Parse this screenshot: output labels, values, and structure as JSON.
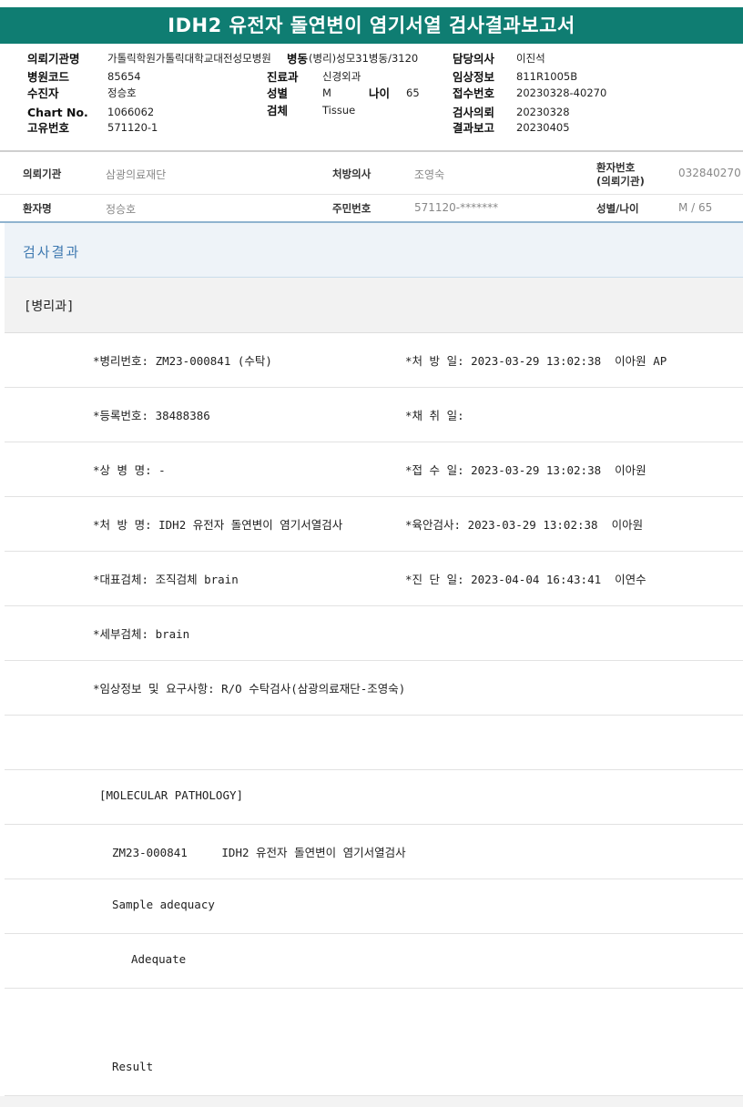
{
  "title": "IDH2 유전자 돌연변이 염기서열 검사결과보고서",
  "info": {
    "requesting_org_label": "의뢰기관명",
    "requesting_org_value": "가톨릭학원가톨릭대학교대전성모병원",
    "ward_label": "병동",
    "ward_value": "(병리)성모31병동/3120",
    "doctor_label": "담당의사",
    "doctor_value": "이진석",
    "hospital_code_label": "병원코드",
    "hospital_code_value": "85654",
    "department_label": "진료과",
    "department_value": "신경외과",
    "clinical_info_label": "임상정보",
    "clinical_info_value": "811R1005B",
    "collector_label": "수진자",
    "collector_value": "정승호",
    "sex_label": "성별",
    "sex_value": "M",
    "age_label": "나이",
    "age_value": "65",
    "receipt_no_label": "접수번호",
    "receipt_no_value": "20230328-40270",
    "chart_no_label": "Chart No.",
    "chart_no_value": "1066062",
    "specimen_label": "검체",
    "specimen_value": "Tissue",
    "request_date_label": "검사의뢰",
    "request_date_value": "20230328",
    "unique_no_label": "고유번호",
    "unique_no_value": "571120-1",
    "report_date_label": "결과보고",
    "report_date_value": "20230405"
  },
  "patient": {
    "org_label": "의뢰기관",
    "org_value": "삼광의료재단",
    "prescriber_label": "처방의사",
    "prescriber_value": "조영숙",
    "patient_no_label_1": "환자번호",
    "patient_no_label_2": "(의뢰기관)",
    "patient_no_value": "032840270",
    "name_label": "환자명",
    "name_value": "정승호",
    "rrn_label": "주민번호",
    "rrn_value": "571120-*******",
    "sexage_label": "성별/나이",
    "sexage_value": "M / 65"
  },
  "section_title": "검사결과",
  "dept": "[병리과]",
  "rows": [
    {
      "left": "*병리번호: ZM23-000841 (수탁)",
      "right": "*처 방 일: 2023-03-29 13:02:38  이아원 AP"
    },
    {
      "left": "*등록번호: 38488386",
      "right": "*채 취 일:"
    },
    {
      "left": "*상 병 명: -",
      "right": "*접 수 일: 2023-03-29 13:02:38  이아원"
    },
    {
      "left": "*처 방 명: IDH2 유전자 돌연변이 염기서열검사",
      "right": "*육안검사: 2023-03-29 13:02:38  이아원"
    },
    {
      "left": "*대표검체: 조직검체 brain",
      "right": "*진 단 일: 2023-04-04 16:43:41  이연수"
    },
    {
      "left": "*세부검체: brain",
      "right": ""
    },
    {
      "left": "*임상정보 및 요구사항: R/O 수탁검사(삼광의료재단-조영숙)",
      "right": ""
    },
    {
      "left": "",
      "right": ""
    },
    {
      "left": "[MOLECULAR PATHOLOGY]",
      "right": ""
    },
    {
      "left": "ZM23-000841     IDH2 유전자 돌연변이 염기서열검사",
      "right": ""
    },
    {
      "left": "Sample adequacy",
      "right": ""
    },
    {
      "left": "Adequate",
      "right": ""
    },
    {
      "left": "",
      "right": ""
    },
    {
      "left": "Result",
      "right": ""
    }
  ]
}
